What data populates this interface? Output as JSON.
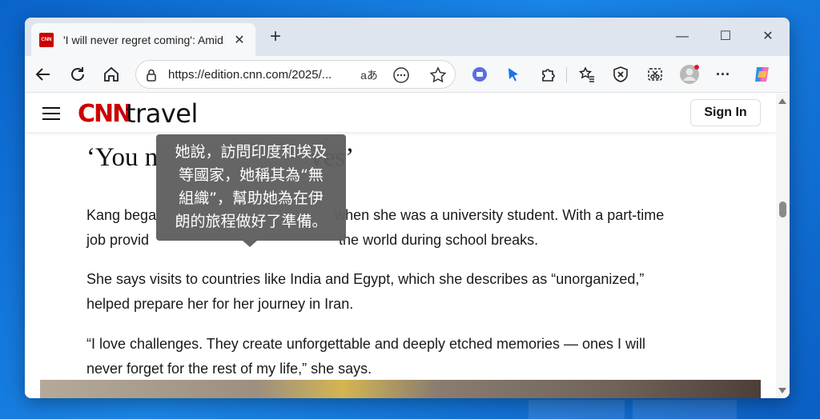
{
  "browser": {
    "tab": {
      "favicon_text": "CNN",
      "title": "'I will never regret coming': Amid",
      "close_symbol": "✕"
    },
    "new_tab_symbol": "+",
    "window_controls": {
      "minimize": "—",
      "maximize": "☐",
      "close": "✕"
    },
    "address_bar": {
      "url": "https://edition.cnn.com/2025/...",
      "read_aloud_label": "aあ"
    },
    "menu_symbol": "···"
  },
  "site": {
    "logo": "CNN",
    "section": "travel",
    "sign_in_label": "Sign In"
  },
  "article": {
    "headline_start": "‘You n",
    "headline_end": "ves’",
    "paragraphs": [
      {
        "line1_start": "Kang bega",
        "line1_end": "when she was a university student. With a part-time",
        "line2_start": "job provid",
        "line2_end": "the world during school breaks."
      },
      {
        "line1": "She says visits to countries like India and Egypt, which she describes as “unorganized,”",
        "line2": "helped prepare her for her journey in Iran."
      },
      {
        "line1": "“I love challenges. They create unforgettable and deeply etched memories — ones I will",
        "line2": "never forget for the rest of my life,” she says."
      }
    ]
  },
  "tooltip": {
    "lines": [
      "她說，訪問印度和埃及",
      "等國家，她稱其為“無",
      "組織”，幫助她為在伊",
      "朗的旅程做好了準備。"
    ]
  },
  "colors": {
    "cnn_red": "#cc0000",
    "desktop_blue": "#0a63c9",
    "tooltip_bg": "#5f5f5f"
  }
}
